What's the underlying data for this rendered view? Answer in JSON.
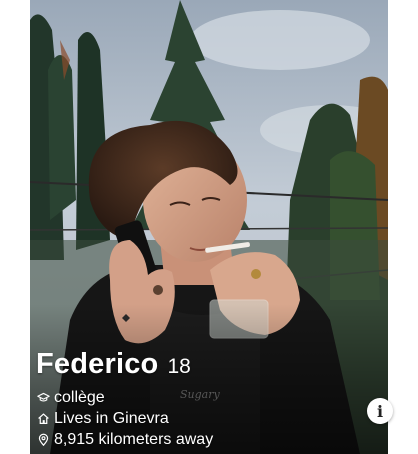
{
  "profile": {
    "name": "Federico",
    "age": "18",
    "details": [
      {
        "icon": "graduation-cap-icon",
        "text": "collège"
      },
      {
        "icon": "home-icon",
        "text": "Lives in Ginevra"
      },
      {
        "icon": "location-pin-icon",
        "text": "8,915 kilometers away"
      }
    ]
  },
  "info_button": {
    "icon": "info-icon",
    "label": "i"
  },
  "colors": {
    "sky": "#a9b6c4",
    "foliage": "#1f3a2a",
    "text": "#ffffff"
  }
}
